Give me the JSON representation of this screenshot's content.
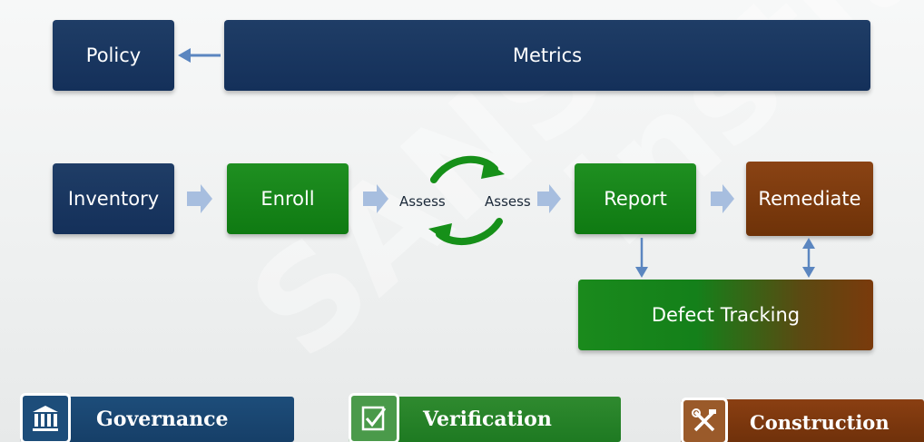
{
  "boxes": {
    "policy": "Policy",
    "metrics": "Metrics",
    "inventory": "Inventory",
    "enroll": "Enroll",
    "report": "Report",
    "remediate": "Remediate",
    "defect_tracking": "Defect Tracking"
  },
  "cycle": {
    "assess_left": "Assess",
    "assess_right": "Assess"
  },
  "legend": {
    "governance": "Governance",
    "verification": "Verification",
    "construction": "Construction"
  },
  "watermark": "SANS Institute, A",
  "colors": {
    "navy": "#1b3760",
    "green": "#148a18",
    "brown": "#7a3a0e",
    "arrow": "#9ab4d8",
    "connector": "#5b86c0"
  },
  "icons": {
    "governance": "building-columns-icon",
    "verification": "checkbox-icon",
    "construction": "tools-icon"
  }
}
